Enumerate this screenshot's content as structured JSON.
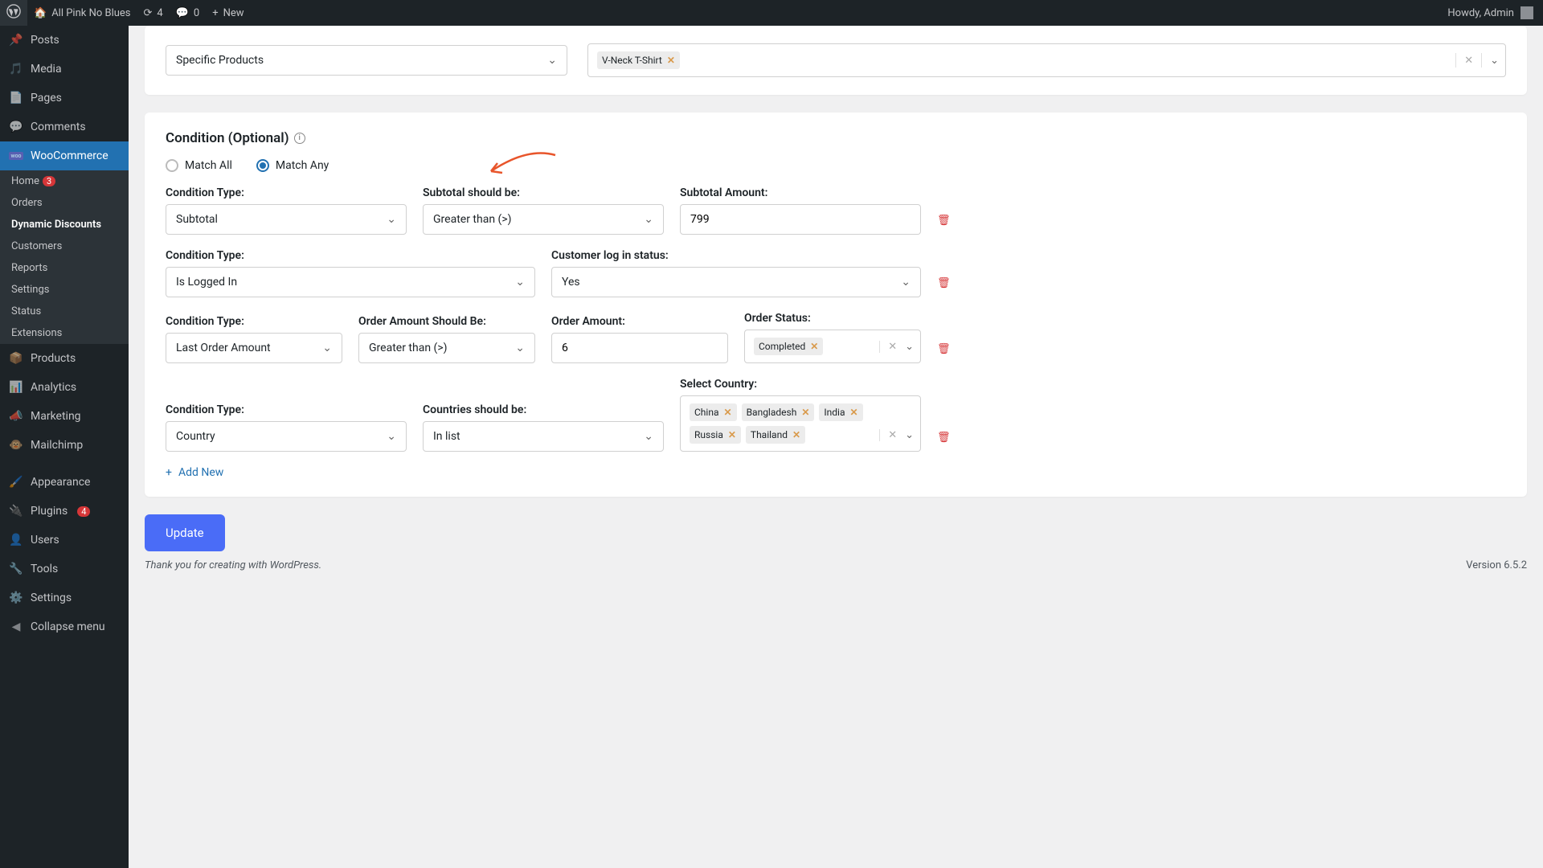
{
  "adminbar": {
    "site": "All Pink No Blues",
    "updates": "4",
    "comments": "0",
    "new": "New",
    "howdy": "Howdy, Admin"
  },
  "sidebar": {
    "posts": "Posts",
    "media": "Media",
    "pages": "Pages",
    "comments": "Comments",
    "woocommerce": "WooCommerce",
    "sub": {
      "home": "Home",
      "home_badge": "3",
      "orders": "Orders",
      "dynamic": "Dynamic Discounts",
      "customers": "Customers",
      "reports": "Reports",
      "settings": "Settings",
      "status": "Status",
      "extensions": "Extensions"
    },
    "products": "Products",
    "analytics": "Analytics",
    "marketing": "Marketing",
    "mailchimp": "Mailchimp",
    "appearance": "Appearance",
    "plugins": "Plugins",
    "plugins_badge": "4",
    "users": "Users",
    "tools": "Tools",
    "settings2": "Settings",
    "collapse": "Collapse menu"
  },
  "top_select": "Specific Products",
  "top_tag": "V-Neck T-Shirt",
  "section_title": "Condition (Optional)",
  "match_all": "Match All",
  "match_any": "Match Any",
  "rows": {
    "r1": {
      "l1": "Condition Type:",
      "v1": "Subtotal",
      "l2": "Subtotal should be:",
      "v2": "Greater than (>)",
      "l3": "Subtotal Amount:",
      "v3": "799"
    },
    "r2": {
      "l1": "Condition Type:",
      "v1": "Is Logged In",
      "l2": "Customer log in status:",
      "v2": "Yes"
    },
    "r3": {
      "l1": "Condition Type:",
      "v1": "Last Order Amount",
      "l2": "Order Amount Should Be:",
      "v2": "Greater than (>)",
      "l3": "Order Amount:",
      "v3": "6",
      "l4": "Order Status:",
      "tag": "Completed"
    },
    "r4": {
      "l1": "Condition Type:",
      "v1": "Country",
      "l2": "Countries should be:",
      "v2": "In list",
      "l3": "Select Country:",
      "tags": {
        "a": "China",
        "b": "Bangladesh",
        "c": "India",
        "d": "Russia",
        "e": "Thailand"
      }
    }
  },
  "add_new": "Add New",
  "update": "Update",
  "footer": {
    "thanks": "Thank you for creating with WordPress.",
    "version": "Version 6.5.2"
  }
}
